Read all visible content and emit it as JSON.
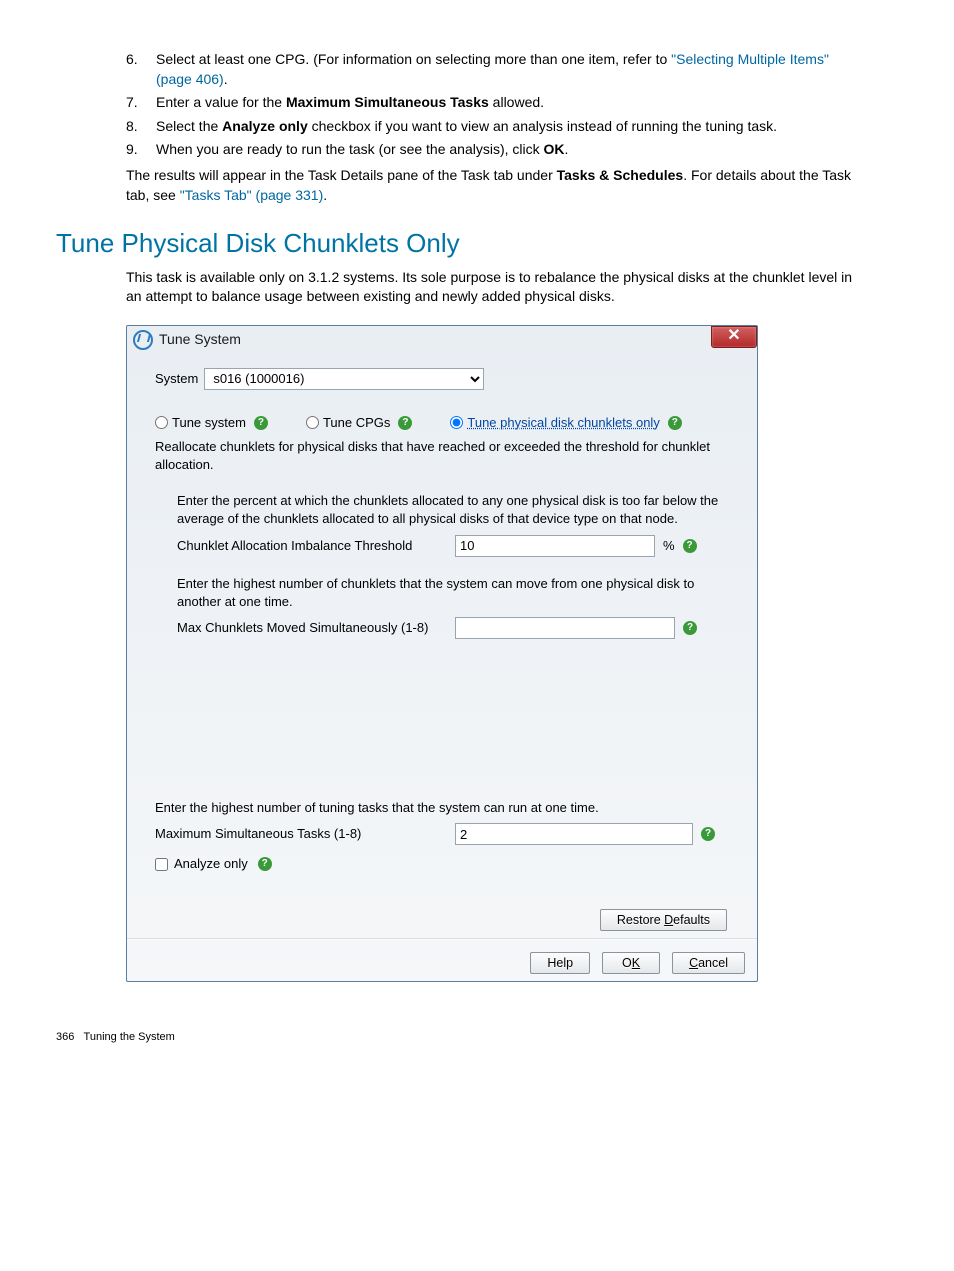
{
  "steps": {
    "s6": {
      "num": "6.",
      "pre": "Select at least one CPG. (For information on selecting more than one item, refer to ",
      "link": "\"Selecting Multiple Items\" (page 406)",
      "post": "."
    },
    "s7": {
      "num": "7.",
      "pre": "Enter a value for the ",
      "bold": "Maximum Simultaneous Tasks",
      "post": " allowed."
    },
    "s8": {
      "num": "8.",
      "pre": "Select the ",
      "bold": "Analyze only",
      "post": " checkbox if you want to view an analysis instead of running the tuning task."
    },
    "s9": {
      "num": "9.",
      "pre": "When you are ready to run the task (or see the analysis), click ",
      "bold": "OK",
      "post": "."
    }
  },
  "results": {
    "pre": "The results will appear in the Task Details pane of the Task tab under ",
    "bold": "Tasks & Schedules",
    "mid": ". For details about the Task tab, see ",
    "link": "\"Tasks Tab\" (page 331)",
    "post": "."
  },
  "section_title": "Tune Physical Disk Chunklets Only",
  "intro": "This task is available only on 3.1.2 systems. Its sole purpose is to rebalance the physical disks at the chunklet level in an attempt to balance usage between existing and newly added physical disks.",
  "dialog": {
    "title": "Tune System",
    "system_label": "System",
    "system_value": "s016 (1000016)",
    "radios": {
      "tune_system": "Tune system",
      "tune_cpgs": "Tune CPGs",
      "tune_pd": "Tune physical disk chunklets only"
    },
    "radio_desc": "Reallocate chunklets for physical disks that have reached or exceeded the threshold for chunklet allocation.",
    "threshold": {
      "hint": "Enter the percent at which the chunklets allocated to any one physical disk is too far below the average of the chunklets allocated to all physical disks of that device type on that node.",
      "label": "Chunklet Allocation Imbalance Threshold",
      "value": "10",
      "unit": "%"
    },
    "maxchunk": {
      "hint": "Enter the highest number of chunklets that the system can move from one physical disk to another at one time.",
      "label": "Max Chunklets Moved Simultaneously (1-8)",
      "value": ""
    },
    "maxtasks": {
      "hint": "Enter the highest number of tuning tasks that the system can run at one time.",
      "label": "Maximum Simultaneous Tasks (1-8)",
      "value": "2"
    },
    "analyze_only": "Analyze only",
    "restore_defaults": {
      "pre": "Restore ",
      "ul": "D",
      "post": "efaults"
    },
    "buttons": {
      "help": "Help",
      "ok": {
        "pre": "O",
        "ul": "K"
      },
      "cancel": {
        "ul": "C",
        "post": "ancel"
      }
    }
  },
  "footer": {
    "page": "366",
    "chapter": "Tuning the System"
  }
}
